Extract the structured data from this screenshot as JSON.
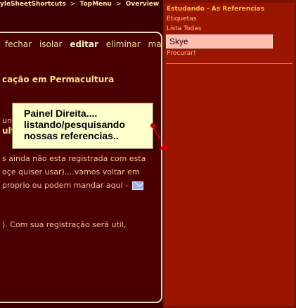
{
  "breadcrumb": {
    "item1": "yleSheetShortcuts",
    "sep1": ">",
    "item2": "TopMenu",
    "sep2": ">",
    "item3": "Overview"
  },
  "toolbar": {
    "fechar": "fechar",
    "isolar": "isolar",
    "editar": "editar",
    "eliminar": "eliminar",
    "mais": "mais"
  },
  "main": {
    "heading": "cação em Permacultura",
    "frag1": "uni",
    "frag2": "ultu",
    "p1": "s ainda não esta registrada com esta",
    "p2": "oçe quiser usar)....vamos voltar em",
    "p3": "proprio ou podem mandar aqui -",
    "p4": "). Com sua registração será util,"
  },
  "callout": {
    "line1": "Painel Direita....",
    "line2": "listando/pesquisando",
    "line3": "nossas referencias.."
  },
  "sidebar": {
    "title": "Estudando - As Referencias",
    "links": [
      "Etiquetas",
      "Lista Todas"
    ],
    "search_value": "Skye",
    "search_label": "Procurar!"
  },
  "icons": {
    "mail": "mail-icon"
  },
  "colors": {
    "background": "#3a0000",
    "panel": "#4a0000",
    "right_panel": "#9b1600",
    "accent_red": "#d10000",
    "callout_bg": "#ffffcc"
  }
}
